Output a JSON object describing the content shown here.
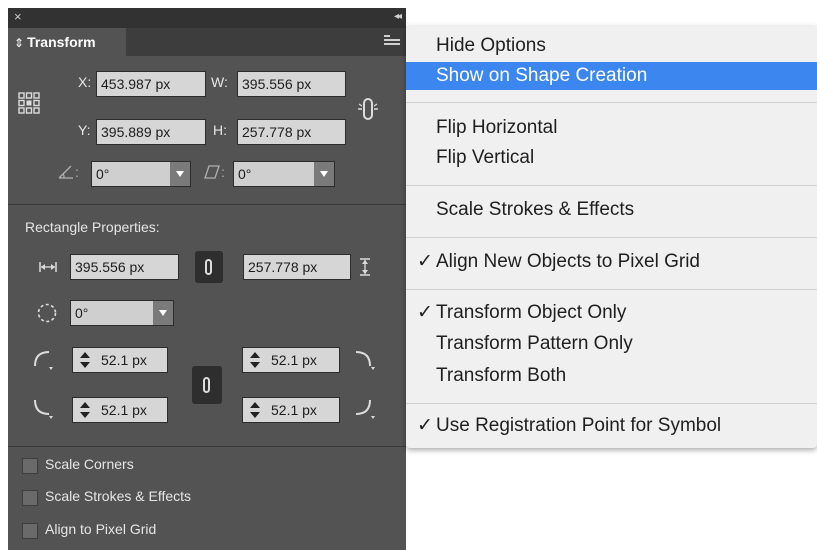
{
  "panel": {
    "close_glyph": "×",
    "collapse_glyph": "◂◂",
    "tab_title": "Transform",
    "x_label": "X:",
    "x_value": "453.987 px",
    "y_label": "Y:",
    "y_value": "395.889 px",
    "w_label": "W:",
    "w_value": "395.556 px",
    "h_label": "H:",
    "h_value": "257.778 px",
    "rotate_label": ":",
    "rotate_value": "0°",
    "shear_label": ":",
    "shear_value": "0°",
    "rect_heading": "Rectangle Properties:",
    "rect_width": "395.556 px",
    "rect_height": "257.778 px",
    "rect_rotation": "0°",
    "corner_tl": "52.1 px",
    "corner_tr": "52.1 px",
    "corner_bl": "52.1 px",
    "corner_br": "52.1 px",
    "checkboxes": [
      "Scale Corners",
      "Scale Strokes & Effects",
      "Align to Pixel Grid"
    ]
  },
  "menu": {
    "items": [
      {
        "label": "Hide Options",
        "checked": false
      },
      {
        "label": "Show on Shape Creation",
        "checked": false
      },
      {
        "label": "Flip Horizontal",
        "checked": false
      },
      {
        "label": "Flip Vertical",
        "checked": false
      },
      {
        "label": "Scale Strokes & Effects",
        "checked": false
      },
      {
        "label": "Align New Objects to Pixel Grid",
        "checked": true
      },
      {
        "label": "Transform Object Only",
        "checked": true
      },
      {
        "label": "Transform Pattern Only",
        "checked": false
      },
      {
        "label": "Transform Both",
        "checked": false
      },
      {
        "label": "Use Registration Point for Symbol",
        "checked": true
      }
    ],
    "check_glyph": "✓",
    "highlight_color": "#3c86f0"
  }
}
